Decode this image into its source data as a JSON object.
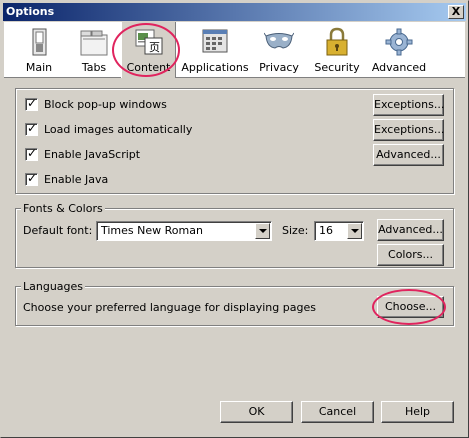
{
  "window": {
    "title": "Options",
    "close_glyph": "X"
  },
  "panes": [
    {
      "id": "main",
      "label": "Main",
      "icon": "switch-icon"
    },
    {
      "id": "tabs",
      "label": "Tabs",
      "icon": "tabs-icon"
    },
    {
      "id": "content",
      "label": "Content",
      "icon": "content-icon",
      "selected": true
    },
    {
      "id": "applications",
      "label": "Applications",
      "icon": "applications-icon"
    },
    {
      "id": "privacy",
      "label": "Privacy",
      "icon": "mask-icon"
    },
    {
      "id": "security",
      "label": "Security",
      "icon": "lock-icon"
    },
    {
      "id": "advanced",
      "label": "Advanced",
      "icon": "gear-icon"
    }
  ],
  "general": {
    "block_popups": {
      "label": "Block pop-up windows",
      "checked": true,
      "button": "Exceptions..."
    },
    "load_images": {
      "label": "Load images automatically",
      "checked": true,
      "button": "Exceptions..."
    },
    "enable_js": {
      "label": "Enable JavaScript",
      "checked": true,
      "button": "Advanced..."
    },
    "enable_java": {
      "label": "Enable Java",
      "checked": true
    }
  },
  "fonts": {
    "group_label": "Fonts & Colors",
    "default_font_label": "Default font:",
    "default_font_value": "Times New Roman",
    "size_label": "Size:",
    "size_value": "16",
    "advanced_button": "Advanced...",
    "colors_button": "Colors..."
  },
  "languages": {
    "group_label": "Languages",
    "description": "Choose your preferred language for displaying pages",
    "choose_button": "Choose..."
  },
  "footer": {
    "ok": "OK",
    "cancel": "Cancel",
    "help": "Help"
  },
  "colors": {
    "highlight_ring": "#e0245e",
    "titlebar_start": "#0a246a",
    "titlebar_end": "#a6caf0",
    "dialog_bg": "#d4d0c8"
  }
}
